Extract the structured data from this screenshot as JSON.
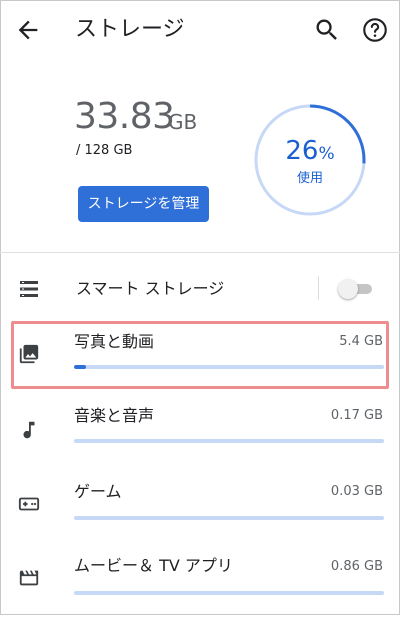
{
  "header": {
    "title": "ストレージ",
    "back_icon": "arrow-back-icon",
    "search_icon": "search-icon",
    "help_icon": "help-circle-icon"
  },
  "summary": {
    "used_value": "33.83",
    "used_unit": "GB",
    "total": "/ 128 GB",
    "manage_button": "ストレージを管理",
    "percent_value": "26",
    "percent_sign": "%",
    "percent_fraction": 0.26,
    "percent_label": "使用"
  },
  "smart_storage": {
    "label": "スマート ストレージ",
    "icon": "list-icon",
    "enabled": false
  },
  "categories": [
    {
      "name": "写真と動画",
      "size": "5.4 GB",
      "icon": "photo-library-icon",
      "fraction": 0.04,
      "highlighted": true
    },
    {
      "name": "音楽と音声",
      "size": "0.17 GB",
      "icon": "music-note-icon",
      "fraction": 0.0
    },
    {
      "name": "ゲーム",
      "size": "0.03 GB",
      "icon": "gamepad-icon",
      "fraction": 0.0
    },
    {
      "name": "ムービー＆ TV アプリ",
      "size": "0.86 GB",
      "icon": "movie-clapper-icon",
      "fraction": 0.0
    }
  ],
  "colors": {
    "accent": "#2f6fd8",
    "track": "#c6d8f5",
    "highlight_border": "#ef8c8e"
  }
}
